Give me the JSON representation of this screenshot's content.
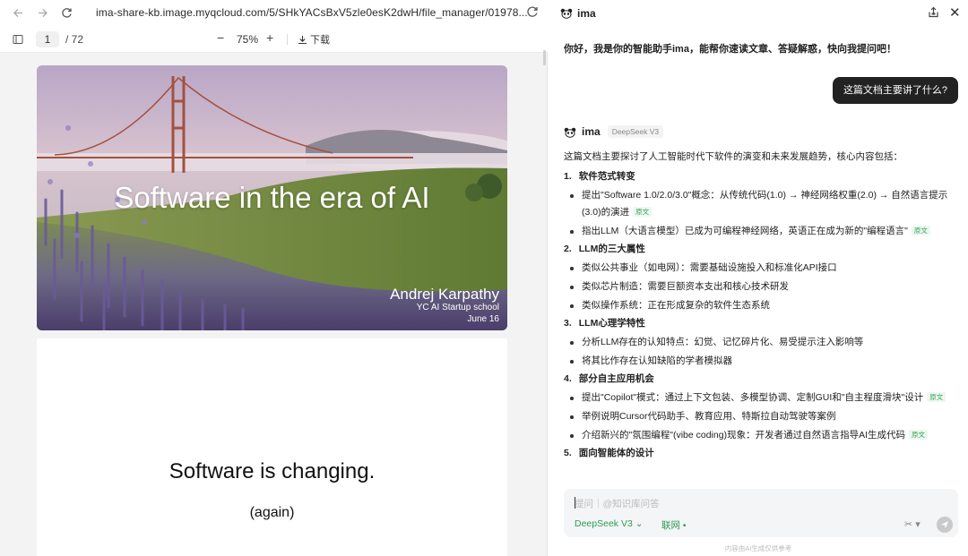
{
  "browser": {
    "url": "ima-share-kb.image.myqcloud.com/5/SHkYACsBxV5zle0esK2dwH/file_manager/01978...",
    "back_icon": "arrow-left-icon",
    "forward_icon": "arrow-right-icon",
    "reload_icon": "reload-icon"
  },
  "viewer": {
    "current_page": "1",
    "total_pages": "/ 72",
    "zoom": "75%",
    "zoom_out": "−",
    "zoom_in": "+",
    "download_label": "下载"
  },
  "slides": {
    "slide1": {
      "title": "Software in the era of AI",
      "author": "Andrej Karpathy",
      "event": "YC AI Startup school",
      "date": "June 16"
    },
    "slide2": {
      "title": "Software is changing.",
      "subtitle": "(again)"
    }
  },
  "assistant": {
    "app_name": "ima",
    "greeting": "你好，我是你的智能助手ima，能帮你速读文章、答疑解惑，快向我提问吧！",
    "user_question": "这篇文档主要讲了什么?",
    "ai_name": "ima",
    "model_tag": "DeepSeek V3",
    "intro": "这篇文档主要探讨了人工智能时代下软件的演变和未来发展趋势，核心内容包括：",
    "source_tag": "原文",
    "sections": [
      {
        "num": "1.",
        "title": "软件范式转变",
        "bullets": [
          {
            "text": "提出\"Software 1.0/2.0/3.0\"概念：从传统代码(1.0) → 神经网络权重(2.0) → 自然语言提示(3.0)的演进",
            "tag": true
          },
          {
            "text": "指出LLM（大语言模型）已成为可编程神经网络，英语正在成为新的\"编程语言\"",
            "tag": true
          }
        ]
      },
      {
        "num": "2.",
        "title": "LLM的三大属性",
        "bullets": [
          {
            "text": "类似公共事业（如电网）：需要基础设施投入和标准化API接口",
            "tag": false
          },
          {
            "text": "类似芯片制造：需要巨额资本支出和核心技术研发",
            "tag": false
          },
          {
            "text": "类似操作系统：正在形成复杂的软件生态系统",
            "tag": false
          }
        ]
      },
      {
        "num": "3.",
        "title": "LLM心理学特性",
        "bullets": [
          {
            "text": "分析LLM存在的认知特点：幻觉、记忆碎片化、易受提示注入影响等",
            "tag": false
          },
          {
            "text": "将其比作存在认知缺陷的学者模拟器",
            "tag": false
          }
        ]
      },
      {
        "num": "4.",
        "title": "部分自主应用机会",
        "bullets": [
          {
            "text": "提出\"Copilot\"模式：通过上下文包装、多模型协调、定制GUI和\"自主程度滑块\"设计",
            "tag": true
          },
          {
            "text": "举例说明Cursor代码助手、教育应用、特斯拉自动驾驶等案例",
            "tag": false
          },
          {
            "text": "介绍新兴的\"氛围编程\"(vibe coding)现象：开发者通过自然语言指导AI生成代码",
            "tag": true
          }
        ]
      },
      {
        "num": "5.",
        "title": "面向智能体的设计",
        "bullets": []
      }
    ],
    "input_placeholder": "提问｜@知识库问答",
    "model_selector": "DeepSeek V3 ⌄",
    "web_toggle": "联网 •",
    "footnote": "内容由AI生成仅供参考"
  },
  "colors": {
    "accent_green": "#2e9c52",
    "bubble_dark": "#222222"
  }
}
